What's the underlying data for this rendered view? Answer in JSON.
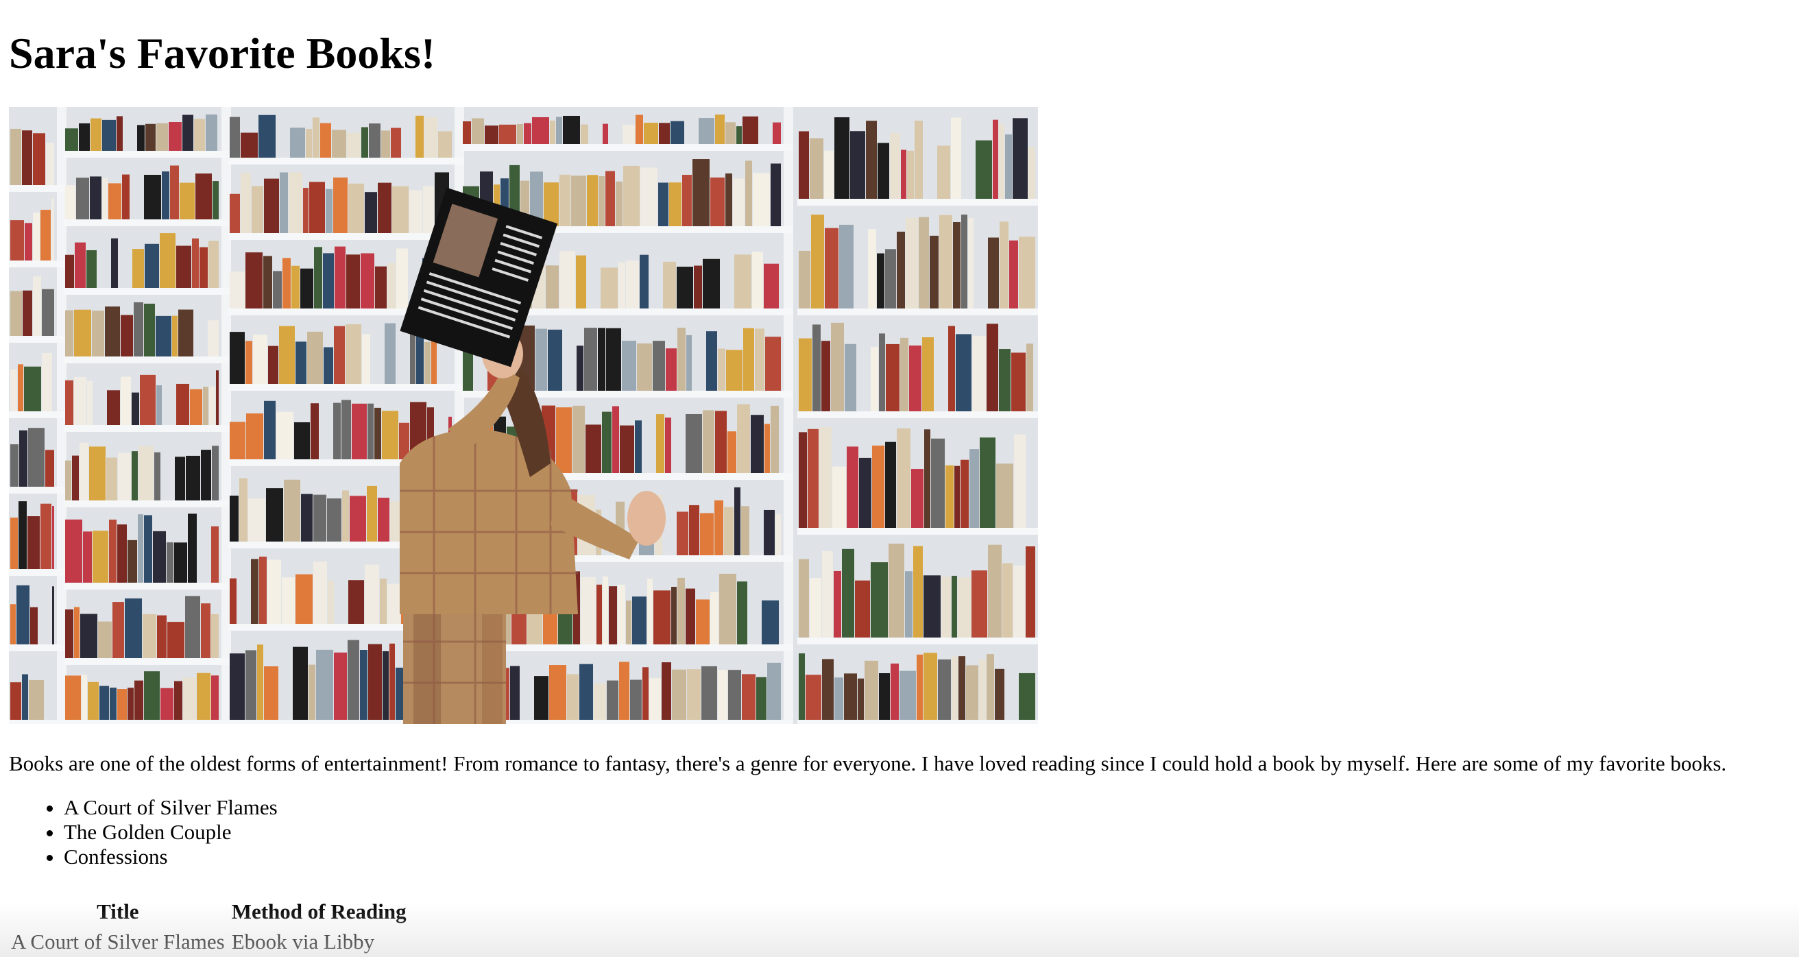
{
  "page": {
    "heading": "Sara's Favorite Books!",
    "image": {
      "alt": "Person holding a book in front of bookshelves",
      "icon": "photo-bookshelf"
    },
    "intro": "Books are one of the oldest forms of entertainment! From romance to fantasy, there's a genre for everyone. I have loved reading since I could hold a book by myself. Here are some of my favorite books.",
    "favorites": [
      "A Court of Silver Flames",
      "The Golden Couple",
      "Confessions"
    ],
    "table": {
      "headers": [
        "Title",
        "Method of Reading"
      ],
      "rows": [
        [
          "A Court of Silver Flames",
          "Ebook via Libby"
        ]
      ]
    }
  }
}
